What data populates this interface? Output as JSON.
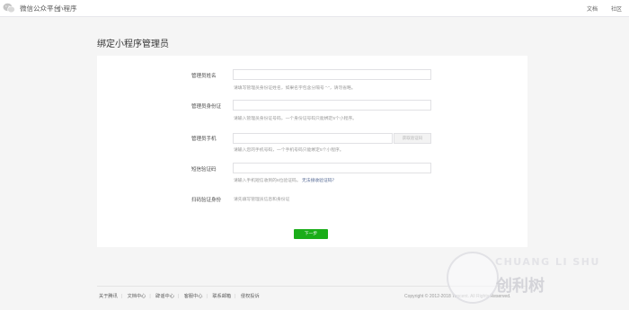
{
  "header": {
    "brand": "微信公众平台",
    "separator": "|",
    "subtitle": "小程序",
    "nav": [
      "文档",
      "社区"
    ]
  },
  "page": {
    "title": "绑定小程序管理员"
  },
  "form": {
    "name_label": "管理员姓名",
    "name_hint": "请填写管理员身份证姓名，如果名字包含分隔号 “·”，请勿省略。",
    "id_label": "管理员身份证",
    "id_hint": "请输入管理员身份证号码，一个身份证号码只能绑定5个小程序。",
    "phone_label": "管理员手机",
    "phone_hint": "请输入您的手机号码，一个手机号码只能绑定5个小程序。",
    "code_button": "获取验证码",
    "sms_label": "短信验证码",
    "sms_hint": "请输入手机短信收到的6位验证码。",
    "sms_link": "无法接收验证码？",
    "scan_label": "扫码验证身份",
    "scan_hint": "请先填写管理员信息和身份证",
    "next_button": "下一步"
  },
  "footer": {
    "links": [
      "关于腾讯",
      "文档中心",
      "辟谣中心",
      "客服中心",
      "联系邮箱",
      "侵权投诉"
    ],
    "copyright": "Copyright © 2012-2018 Tencent. All Rights Reserved."
  },
  "watermark": {
    "en": "CHUANG LI SHU",
    "cn": "创利树"
  },
  "colors": {
    "background": "#f5f5f5",
    "card": "#ffffff",
    "primary_green": "#1aad19",
    "link": "#576b95",
    "hint_gray": "#9a9a9a"
  }
}
